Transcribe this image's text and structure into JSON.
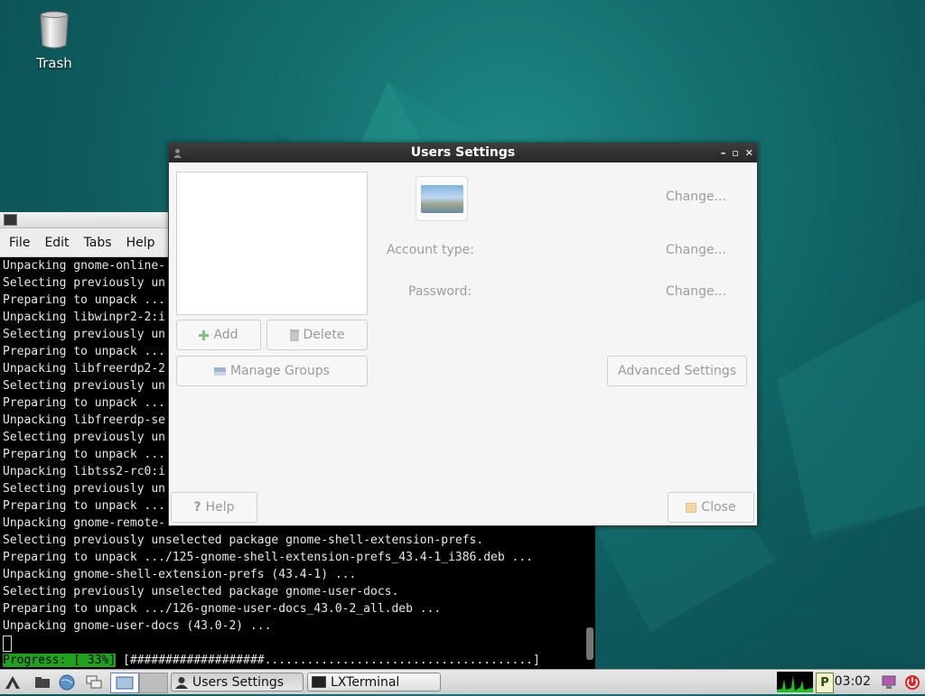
{
  "desktop": {
    "trash_label": "Trash"
  },
  "terminal": {
    "menu": [
      "File",
      "Edit",
      "Tabs",
      "Help"
    ],
    "lines": [
      "Unpacking gnome-online-",
      "Selecting previously un",
      "Preparing to unpack ...",
      "Unpacking libwinpr2-2:i",
      "Selecting previously un",
      "Preparing to unpack ...",
      "Unpacking libfreerdp2-2",
      "Selecting previously un",
      "Preparing to unpack ...",
      "Unpacking libfreerdp-se",
      "Selecting previously un",
      "Preparing to unpack ...",
      "Unpacking libtss2-rc0:i",
      "Selecting previously un",
      "Preparing to unpack ...",
      "Unpacking gnome-remote-",
      "Selecting previously unselected package gnome-shell-extension-prefs.",
      "Preparing to unpack .../125-gnome-shell-extension-prefs_43.4-1_i386.deb ...",
      "Unpacking gnome-shell-extension-prefs (43.4-1) ...",
      "Selecting previously unselected package gnome-user-docs.",
      "Preparing to unpack .../126-gnome-user-docs_43.0-2_all.deb ...",
      "Unpacking gnome-user-docs (43.0-2) ..."
    ],
    "progress_label": "Progress: [ 33%]",
    "progress_bar": "[###################......................................]"
  },
  "dialog": {
    "title": "Users Settings",
    "change_label": "Change...",
    "account_type_label": "Account type:",
    "password_label": "Password:",
    "add_label": "Add",
    "delete_label": "Delete",
    "manage_groups_label": "Manage Groups",
    "advanced_settings_label": "Advanced Settings",
    "help_label": "Help",
    "close_label": "Close"
  },
  "taskbar": {
    "tasks": [
      "Users Settings",
      "LXTerminal"
    ],
    "clock": "03:02",
    "indicator_letter": "P"
  }
}
